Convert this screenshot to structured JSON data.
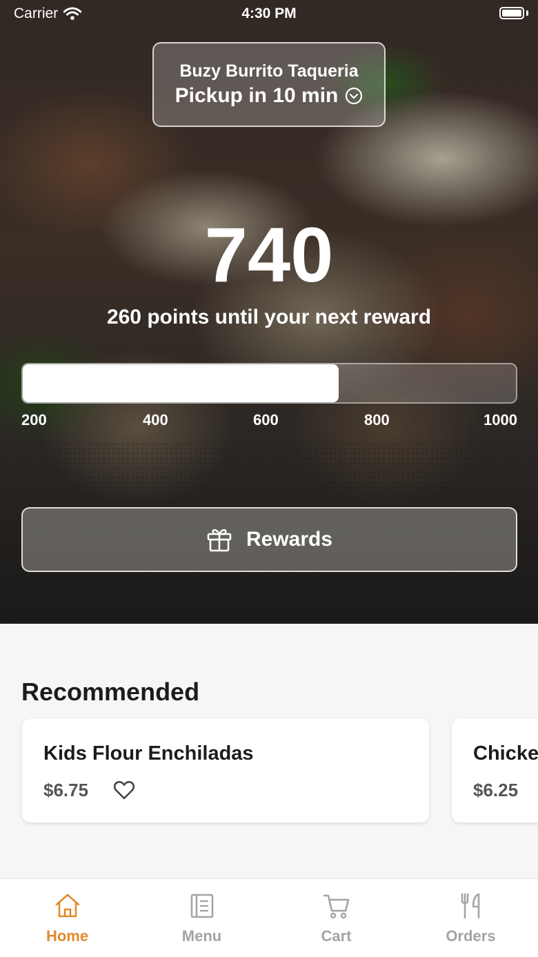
{
  "status_bar": {
    "carrier": "Carrier",
    "time": "4:30 PM"
  },
  "store": {
    "name": "Buzy Burrito Taqueria",
    "pickup": "Pickup in 10 min"
  },
  "rewards": {
    "points": "740",
    "subtitle": "260 points until your next reward",
    "progress_fraction": 0.64,
    "scale_labels": [
      "200",
      "400",
      "600",
      "800",
      "1000"
    ],
    "button_label": "Rewards"
  },
  "recommended": {
    "title": "Recommended",
    "items": [
      {
        "name": "Kids Flour Enchiladas",
        "price": "$6.75"
      },
      {
        "name": "Chicke",
        "price": "$6.25"
      }
    ]
  },
  "tabs": [
    {
      "label": "Home",
      "icon": "home-icon",
      "active": true
    },
    {
      "label": "Menu",
      "icon": "menu-icon",
      "active": false
    },
    {
      "label": "Cart",
      "icon": "cart-icon",
      "active": false
    },
    {
      "label": "Orders",
      "icon": "orders-icon",
      "active": false
    }
  ],
  "colors": {
    "accent": "#e3892b",
    "inactive": "#a4a4a4"
  }
}
